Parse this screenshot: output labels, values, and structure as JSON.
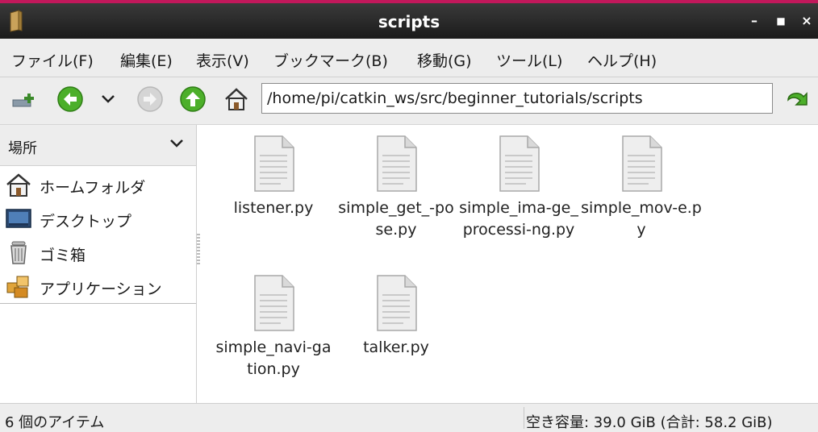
{
  "window": {
    "title": "scripts"
  },
  "menubar": {
    "items": [
      "ファイル(F)",
      "編集(E)",
      "表示(V)",
      "ブックマーク(B)",
      "移動(G)",
      "ツール(L)",
      "ヘルプ(H)"
    ]
  },
  "toolbar": {
    "path_value": "/home/pi/catkin_ws/src/beginner_tutorials/scripts"
  },
  "sidebar": {
    "header": "場所",
    "places": [
      "ホームフォルダ",
      "デスクトップ",
      "ゴミ箱",
      "アプリケーション"
    ]
  },
  "files": [
    "listener.py",
    "simple_get_-pose.py",
    "simple_ima-ge_processi-ng.py",
    "simple_mov-e.py",
    "simple_navi-gation.py",
    "talker.py"
  ],
  "status": {
    "items": "6 個のアイテム",
    "free_space": "空き容量: 39.0 GiB (合計: 58.2 GiB)"
  },
  "colors": {
    "accent_strip": "#c2185b",
    "titlebar": "#2a2a2a",
    "nav_green": "#4caf2a"
  },
  "icons": {
    "app": "folder-book-icon",
    "new_tab": "new-tab-icon",
    "back": "back-arrow-icon",
    "history": "chevron-down-icon",
    "forward": "forward-arrow-icon",
    "up": "up-arrow-icon",
    "home": "home-icon",
    "go": "go-arrow-icon"
  }
}
